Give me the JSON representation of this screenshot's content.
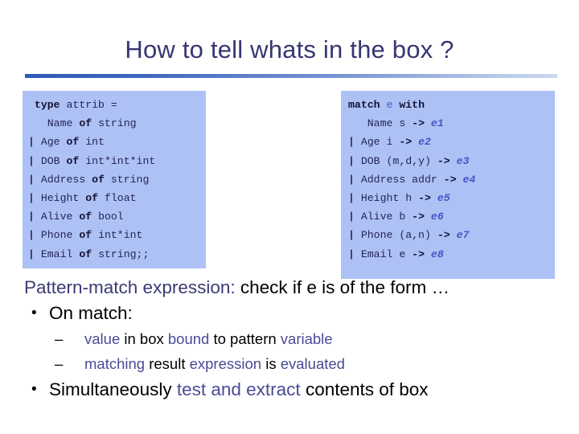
{
  "slide": {
    "title": "How to tell whats in the box ?",
    "accent_color": "#363672",
    "code_bg_color": "#aec1f5",
    "blue_text_color": "#3b3b74"
  },
  "code_type": {
    "name": "type-definition-block",
    "lines": [
      {
        "bar": "",
        "kw1": "type",
        "mid": " attrib =",
        "kw2": "",
        "tail": ""
      },
      {
        "bar": "",
        "kw1": "",
        "mid": "  Name ",
        "kw2": "of",
        "tail": " string"
      },
      {
        "bar": "|",
        "kw1": "",
        "mid": " Age ",
        "kw2": "of",
        "tail": " int"
      },
      {
        "bar": "|",
        "kw1": "",
        "mid": " DOB ",
        "kw2": "of",
        "tail": " int*int*int"
      },
      {
        "bar": "|",
        "kw1": "",
        "mid": " Address ",
        "kw2": "of",
        "tail": " string"
      },
      {
        "bar": "|",
        "kw1": "",
        "mid": " Height ",
        "kw2": "of",
        "tail": " float"
      },
      {
        "bar": "|",
        "kw1": "",
        "mid": " Alive ",
        "kw2": "of",
        "tail": " bool"
      },
      {
        "bar": "|",
        "kw1": "",
        "mid": " Phone ",
        "kw2": "of",
        "tail": " int*int"
      },
      {
        "bar": "|",
        "kw1": "",
        "mid": " Email ",
        "kw2": "of",
        "tail": " string;;"
      }
    ]
  },
  "code_match": {
    "name": "match-expression-block",
    "header": {
      "kw1": "match",
      "scrutinee": "e",
      "kw2": "with"
    },
    "lines": [
      {
        "bar": "",
        "pattern": "  Name s ",
        "arrow": "->",
        "result": "e1"
      },
      {
        "bar": "|",
        "pattern": " Age i ",
        "arrow": "->",
        "result": "e2"
      },
      {
        "bar": "|",
        "pattern": " DOB (m,d,y) ",
        "arrow": "->",
        "result": "e3"
      },
      {
        "bar": "|",
        "pattern": " Address addr ",
        "arrow": "->",
        "result": "e4"
      },
      {
        "bar": "|",
        "pattern": " Height h ",
        "arrow": "->",
        "result": "e5"
      },
      {
        "bar": "|",
        "pattern": " Alive b ",
        "arrow": "->",
        "result": "e6"
      },
      {
        "bar": "|",
        "pattern": " Phone (a,n) ",
        "arrow": "->",
        "result": "e7"
      },
      {
        "bar": "|",
        "pattern": " Email e ",
        "arrow": "->",
        "result": "e8"
      }
    ]
  },
  "body": {
    "lead": {
      "blue_part": "Pattern-match expression:",
      "black_part": " check if e is of the form …"
    },
    "bullet_on_match": {
      "marker": "•",
      "text": "On match:"
    },
    "sub_bullets": [
      {
        "marker": "–",
        "segments": [
          {
            "text": "value",
            "color": "blue"
          },
          {
            "text": " in box ",
            "color": "black"
          },
          {
            "text": "bound",
            "color": "blue"
          },
          {
            "text": " to pattern ",
            "color": "black"
          },
          {
            "text": "variable",
            "color": "blue"
          }
        ]
      },
      {
        "marker": "–",
        "segments": [
          {
            "text": "matching",
            "color": "blue"
          },
          {
            "text": " result ",
            "color": "black"
          },
          {
            "text": "expression",
            "color": "blue"
          },
          {
            "text": " is ",
            "color": "black"
          },
          {
            "text": "evaluated",
            "color": "blue"
          }
        ]
      }
    ],
    "bullet_simultaneous": {
      "marker": "•",
      "segments": [
        {
          "text": "Simultaneously ",
          "color": "black"
        },
        {
          "text": "test and extract",
          "color": "blue"
        },
        {
          "text": " contents of box",
          "color": "black"
        }
      ]
    }
  }
}
